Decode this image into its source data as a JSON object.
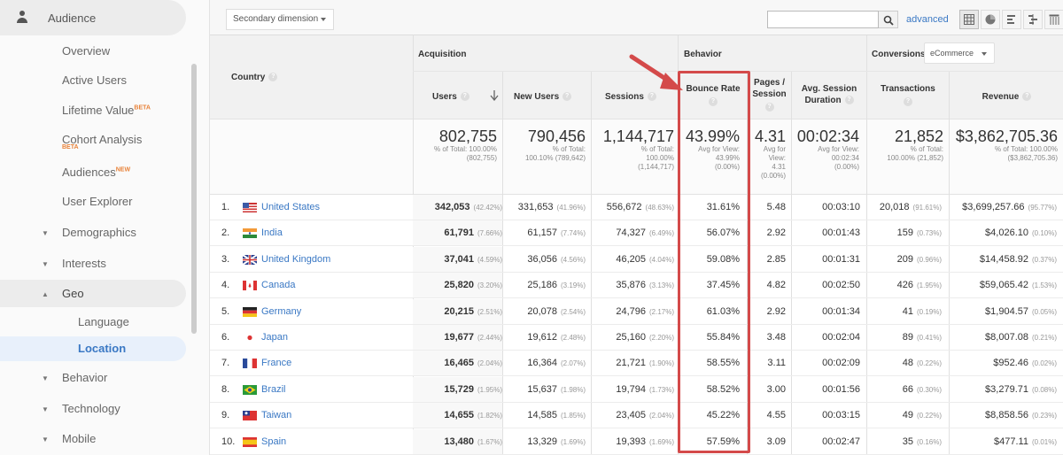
{
  "sidebar": {
    "section": {
      "label": "Audience",
      "icon": "person-icon"
    },
    "items": [
      {
        "label": "Overview"
      },
      {
        "label": "Active Users"
      },
      {
        "label": "Lifetime Value",
        "badge": "BETA"
      },
      {
        "label": "Cohort Analysis",
        "badge": "BETA"
      },
      {
        "label": "Audiences",
        "badge": "NEW"
      },
      {
        "label": "User Explorer"
      },
      {
        "label": "Demographics",
        "caret": "▼"
      },
      {
        "label": "Interests",
        "caret": "▼"
      },
      {
        "label": "Geo",
        "caret": "▲"
      },
      {
        "label": "Behavior",
        "caret": "▼"
      },
      {
        "label": "Technology",
        "caret": "▼"
      },
      {
        "label": "Mobile",
        "caret": "▼"
      }
    ],
    "geo_sub": [
      {
        "label": "Language"
      },
      {
        "label": "Location",
        "active": true
      }
    ]
  },
  "toolbar": {
    "secondary_dimension": "Secondary dimension",
    "search_value": "",
    "advanced": "advanced",
    "view_icons": [
      "table-view-icon",
      "pie-view-icon",
      "performance-view-icon",
      "comparison-view-icon",
      "pivot-view-icon"
    ]
  },
  "table": {
    "groups": {
      "acquisition": "Acquisition",
      "behavior": "Behavior",
      "conversions": "Conversions",
      "conversions_select": "eCommerce"
    },
    "headers": {
      "country": "Country",
      "users": "Users",
      "new_users": "New Users",
      "sessions": "Sessions",
      "bounce_rate": "Bounce Rate",
      "pages_session_1": "Pages /",
      "pages_session_2": "Session",
      "avg_dur_1": "Avg. Session",
      "avg_dur_2": "Duration",
      "transactions": "Transactions",
      "revenue": "Revenue",
      "help": "?"
    },
    "summary": {
      "users": {
        "value": "802,755",
        "l1": "% of Total: 100.00%",
        "l2": "(802,755)"
      },
      "new_users": {
        "value": "790,456",
        "l1": "% of Total:",
        "l2": "100.10% (789,642)"
      },
      "sessions": {
        "value": "1,144,717",
        "l1": "% of Total:",
        "l2": "100.00%",
        "l3": "(1,144,717)"
      },
      "bounce_rate": {
        "value": "43.99%",
        "l1": "Avg for View:",
        "l2": "43.99%",
        "l3": "(0.00%)"
      },
      "pages_session": {
        "value": "4.31",
        "l1": "Avg for",
        "l2": "View:",
        "l3": "4.31",
        "l4": "(0.00%)"
      },
      "avg_duration": {
        "value": "00:02:34",
        "l1": "Avg for View:",
        "l2": "00:02:34",
        "l3": "(0.00%)"
      },
      "transactions": {
        "value": "21,852",
        "l1": "% of Total:",
        "l2": "100.00% (21,852)"
      },
      "revenue": {
        "value": "$3,862,705.36",
        "l1": "% of Total: 100.00%",
        "l2": "($3,862,705.36)"
      }
    },
    "rows": [
      {
        "num": "1.",
        "flag": "us",
        "country": "United States",
        "users": "342,053",
        "users_pct": "(42.42%)",
        "new_users": "331,653",
        "new_users_pct": "(41.96%)",
        "sessions": "556,672",
        "sessions_pct": "(48.63%)",
        "bounce": "31.61%",
        "pages": "5.48",
        "duration": "00:03:10",
        "tx": "20,018",
        "tx_pct": "(91.61%)",
        "rev": "$3,699,257.66",
        "rev_pct": "(95.77%)"
      },
      {
        "num": "2.",
        "flag": "in",
        "country": "India",
        "users": "61,791",
        "users_pct": "(7.66%)",
        "new_users": "61,157",
        "new_users_pct": "(7.74%)",
        "sessions": "74,327",
        "sessions_pct": "(6.49%)",
        "bounce": "56.07%",
        "pages": "2.92",
        "duration": "00:01:43",
        "tx": "159",
        "tx_pct": "(0.73%)",
        "rev": "$4,026.10",
        "rev_pct": "(0.10%)"
      },
      {
        "num": "3.",
        "flag": "gb",
        "country": "United Kingdom",
        "users": "37,041",
        "users_pct": "(4.59%)",
        "new_users": "36,056",
        "new_users_pct": "(4.56%)",
        "sessions": "46,205",
        "sessions_pct": "(4.04%)",
        "bounce": "59.08%",
        "pages": "2.85",
        "duration": "00:01:31",
        "tx": "209",
        "tx_pct": "(0.96%)",
        "rev": "$14,458.92",
        "rev_pct": "(0.37%)"
      },
      {
        "num": "4.",
        "flag": "ca",
        "country": "Canada",
        "users": "25,820",
        "users_pct": "(3.20%)",
        "new_users": "25,186",
        "new_users_pct": "(3.19%)",
        "sessions": "35,876",
        "sessions_pct": "(3.13%)",
        "bounce": "37.45%",
        "pages": "4.82",
        "duration": "00:02:50",
        "tx": "426",
        "tx_pct": "(1.95%)",
        "rev": "$59,065.42",
        "rev_pct": "(1.53%)"
      },
      {
        "num": "5.",
        "flag": "de",
        "country": "Germany",
        "users": "20,215",
        "users_pct": "(2.51%)",
        "new_users": "20,078",
        "new_users_pct": "(2.54%)",
        "sessions": "24,796",
        "sessions_pct": "(2.17%)",
        "bounce": "61.03%",
        "pages": "2.92",
        "duration": "00:01:34",
        "tx": "41",
        "tx_pct": "(0.19%)",
        "rev": "$1,904.57",
        "rev_pct": "(0.05%)"
      },
      {
        "num": "6.",
        "flag": "jp",
        "country": "Japan",
        "users": "19,677",
        "users_pct": "(2.44%)",
        "new_users": "19,612",
        "new_users_pct": "(2.48%)",
        "sessions": "25,160",
        "sessions_pct": "(2.20%)",
        "bounce": "55.84%",
        "pages": "3.48",
        "duration": "00:02:04",
        "tx": "89",
        "tx_pct": "(0.41%)",
        "rev": "$8,007.08",
        "rev_pct": "(0.21%)"
      },
      {
        "num": "7.",
        "flag": "fr",
        "country": "France",
        "users": "16,465",
        "users_pct": "(2.04%)",
        "new_users": "16,364",
        "new_users_pct": "(2.07%)",
        "sessions": "21,721",
        "sessions_pct": "(1.90%)",
        "bounce": "58.55%",
        "pages": "3.11",
        "duration": "00:02:09",
        "tx": "48",
        "tx_pct": "(0.22%)",
        "rev": "$952.46",
        "rev_pct": "(0.02%)"
      },
      {
        "num": "8.",
        "flag": "br",
        "country": "Brazil",
        "users": "15,729",
        "users_pct": "(1.95%)",
        "new_users": "15,637",
        "new_users_pct": "(1.98%)",
        "sessions": "19,794",
        "sessions_pct": "(1.73%)",
        "bounce": "58.52%",
        "pages": "3.00",
        "duration": "00:01:56",
        "tx": "66",
        "tx_pct": "(0.30%)",
        "rev": "$3,279.71",
        "rev_pct": "(0.08%)"
      },
      {
        "num": "9.",
        "flag": "tw",
        "country": "Taiwan",
        "users": "14,655",
        "users_pct": "(1.82%)",
        "new_users": "14,585",
        "new_users_pct": "(1.85%)",
        "sessions": "23,405",
        "sessions_pct": "(2.04%)",
        "bounce": "45.22%",
        "pages": "4.55",
        "duration": "00:03:15",
        "tx": "49",
        "tx_pct": "(0.22%)",
        "rev": "$8,858.56",
        "rev_pct": "(0.23%)"
      },
      {
        "num": "10.",
        "flag": "es",
        "country": "Spain",
        "users": "13,480",
        "users_pct": "(1.67%)",
        "new_users": "13,329",
        "new_users_pct": "(1.69%)",
        "sessions": "19,393",
        "sessions_pct": "(1.69%)",
        "bounce": "57.59%",
        "pages": "3.09",
        "duration": "00:02:47",
        "tx": "35",
        "tx_pct": "(0.16%)",
        "rev": "$477.11",
        "rev_pct": "(0.01%)"
      }
    ]
  },
  "annotation": {
    "highlight_color": "#d44a4a",
    "highlighted_column": "Bounce Rate"
  }
}
